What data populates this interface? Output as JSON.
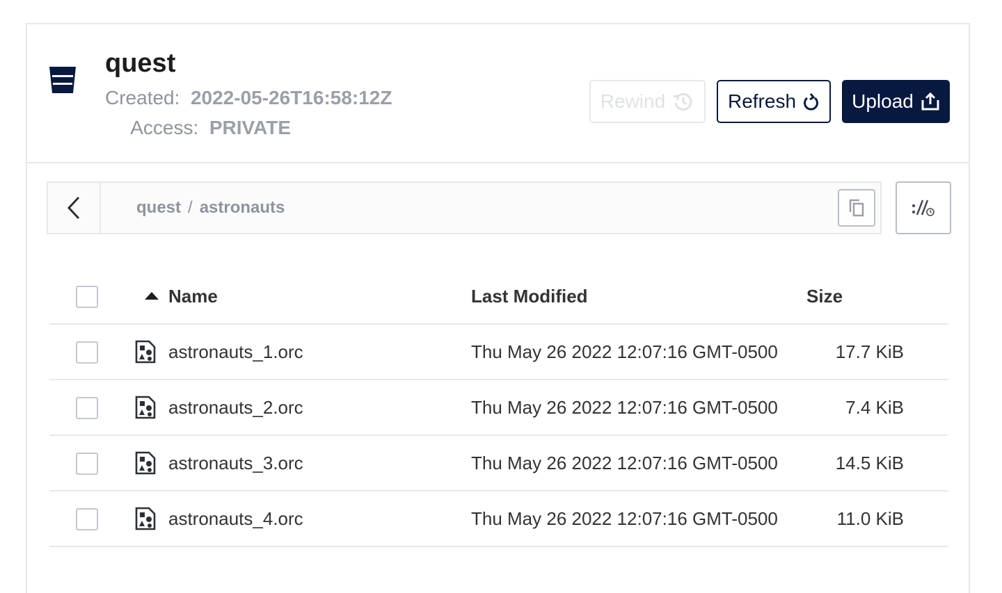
{
  "bucket": {
    "name": "quest",
    "created_label": "Created:",
    "created_value": "2022-05-26T16:58:12Z",
    "access_label": "Access:",
    "access_value": "PRIVATE"
  },
  "actions": {
    "rewind_label": "Rewind",
    "refresh_label": "Refresh",
    "upload_label": "Upload"
  },
  "path": {
    "segments": [
      "quest",
      "astronauts"
    ],
    "separator": "/"
  },
  "table": {
    "columns": [
      "Name",
      "Last Modified",
      "Size"
    ],
    "sort": {
      "column": "Name",
      "direction": "ascending"
    },
    "rows": [
      {
        "name": "astronauts_1.orc",
        "modified": "Thu May 26 2022 12:07:16 GMT-0500",
        "size": "17.7 KiB"
      },
      {
        "name": "astronauts_2.orc",
        "modified": "Thu May 26 2022 12:07:16 GMT-0500",
        "size": "7.4 KiB"
      },
      {
        "name": "astronauts_3.orc",
        "modified": "Thu May 26 2022 12:07:16 GMT-0500",
        "size": "14.5 KiB"
      },
      {
        "name": "astronauts_4.orc",
        "modified": "Thu May 26 2022 12:07:16 GMT-0500",
        "size": "11.0 KiB"
      }
    ]
  },
  "icons": {
    "bucket": "bucket-icon",
    "rewind": "history-icon",
    "refresh": "refresh-icon",
    "upload": "upload-icon",
    "back": "chevron-left-icon",
    "copy": "copy-icon",
    "rewind_toggle": "rewind-path-icon",
    "sort": "sort-ascending-icon",
    "file": "file-icon"
  },
  "colors": {
    "primary": "#07193e",
    "border": "#e6e8ec",
    "muted_text": "#8e949c",
    "body_text": "#333333"
  }
}
